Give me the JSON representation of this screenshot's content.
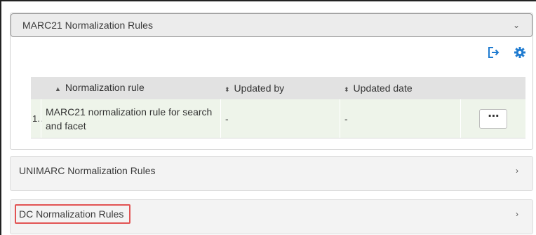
{
  "panels": {
    "marc": {
      "title": "MARC21 Normalization Rules",
      "toggle": "⌄"
    },
    "unimarc": {
      "title": "UNIMARC Normalization Rules",
      "toggle": "›"
    },
    "dc": {
      "title": "DC Normalization Rules",
      "toggle": "›"
    }
  },
  "toolbar": {
    "icons": [
      "export-icon",
      "gear-icon"
    ]
  },
  "table": {
    "headers": {
      "rule": "Normalization rule",
      "updated_by": "Updated by",
      "updated_date": "Updated date"
    },
    "sort_glyphs": {
      "rule": "▲",
      "updated_by": "⬍",
      "updated_date": "⬍"
    },
    "rows": [
      {
        "index": "1..",
        "rule": "MARC21 normalization rule for search and facet",
        "updated_by": "-",
        "updated_date": "-",
        "action": "⋯"
      }
    ]
  },
  "colors": {
    "accent": "#1f7bd0",
    "highlight_border": "#e25353",
    "row_bg": "#eef4ea"
  }
}
